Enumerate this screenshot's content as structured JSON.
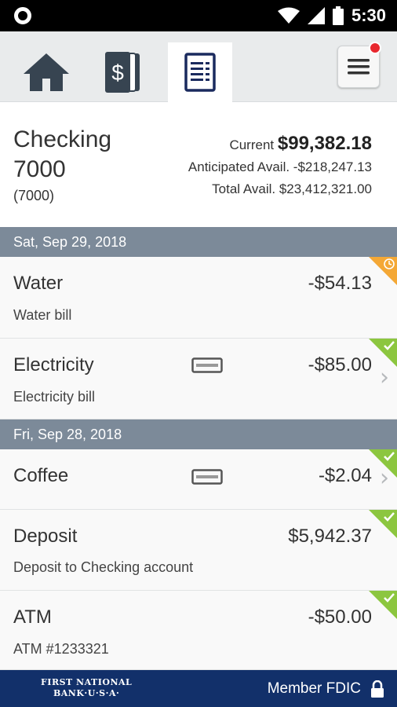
{
  "status_bar": {
    "time": "5:30"
  },
  "tabs": [
    {
      "icon": "home-icon"
    },
    {
      "icon": "dollar-card-icon"
    },
    {
      "icon": "register-list-icon",
      "active": true
    }
  ],
  "menu": {
    "icon": "hamburger-menu-icon",
    "has_notification": true
  },
  "account": {
    "name": "Checking 7000",
    "number": "(7000)",
    "current_label": "Current",
    "current_value": "$99,382.18",
    "anticipated": "Anticipated Avail. -$218,247.13",
    "total": "Total Avail. $23,412,321.00"
  },
  "groups": [
    {
      "date": "Sat, Sep 29, 2018",
      "transactions": [
        {
          "title": "Water",
          "description": "Water bill",
          "amount": "-$54.13",
          "status": "pending"
        },
        {
          "title": "Electricity",
          "description": "Electricity bill",
          "amount": "-$85.00",
          "status": "cleared",
          "card": true,
          "chevron": true
        }
      ]
    },
    {
      "date": "Fri, Sep 28, 2018",
      "transactions": [
        {
          "title": "Coffee",
          "description": "",
          "amount": "-$2.04",
          "status": "cleared",
          "card": true,
          "chevron": true
        },
        {
          "title": "Deposit",
          "description": "Deposit to Checking account",
          "amount": "$5,942.37",
          "status": "cleared"
        },
        {
          "title": "ATM",
          "description": "ATM #1233321",
          "amount": "-$50.00",
          "status": "cleared"
        }
      ]
    }
  ],
  "footer": {
    "logo_line1": "FIRST NATIONAL",
    "logo_line2": "BANK·U·S·A·",
    "member": "Member FDIC"
  },
  "colors": {
    "nav_blue": "#1a2a5e",
    "date_header": "#7c8a99",
    "cleared": "#8cc63f",
    "pending": "#f4a836",
    "footer": "#12306a"
  }
}
